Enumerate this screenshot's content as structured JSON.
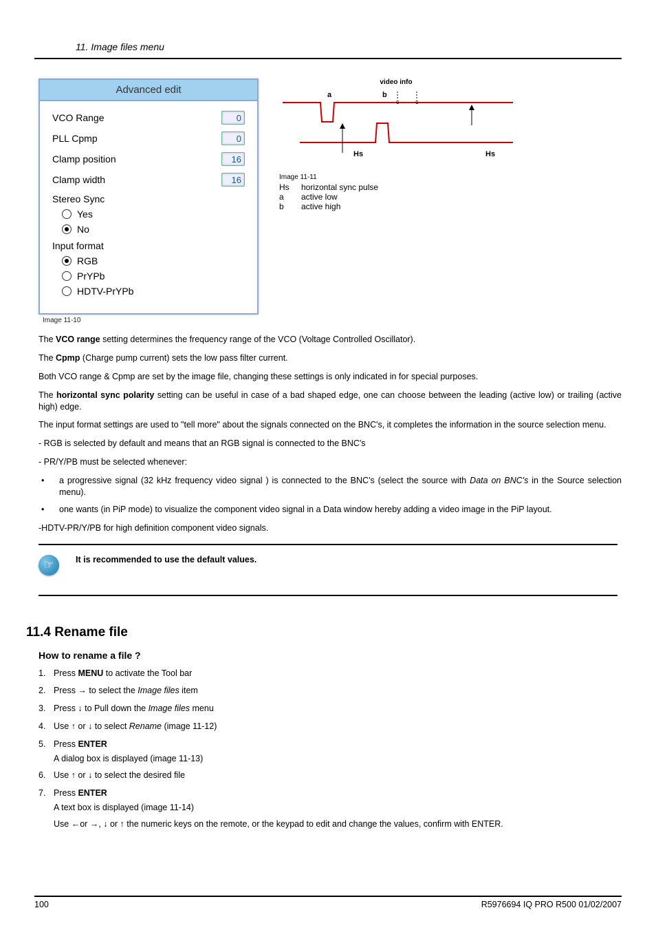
{
  "chapter": "11.  Image files menu",
  "dialog": {
    "title": "Advanced edit",
    "params": [
      {
        "label": "VCO Range",
        "value": "0"
      },
      {
        "label": "PLL Cpmp",
        "value": "0"
      },
      {
        "label": "Clamp position",
        "value": "16"
      },
      {
        "label": "Clamp width",
        "value": "16"
      }
    ],
    "stereo_label": "Stereo Sync",
    "stereo_yes": "Yes",
    "stereo_no": "No",
    "format_label": "Input format",
    "format_rgb": "RGB",
    "format_prypb": "PrYPb",
    "format_hdtv": "HDTV-PrYPb"
  },
  "img_caption_left": "Image 11-10",
  "diagram": {
    "title": "video info",
    "a": "a",
    "b": "b",
    "hs1": "Hs",
    "hs2": "Hs",
    "caption": "Image 11-11",
    "legend": [
      {
        "k": "Hs",
        "v": "horizontal sync pulse"
      },
      {
        "k": "a",
        "v": "active low"
      },
      {
        "k": "b",
        "v": "active high"
      }
    ]
  },
  "para": {
    "p1a": "The ",
    "p1b": "VCO range",
    "p1c": " setting determines the frequency range of the VCO (Voltage Controlled Oscillator).",
    "p2a": "The ",
    "p2b": "Cpmp",
    "p2c": " (Charge pump current) sets the low pass filter current.",
    "p3": "Both VCO range & Cpmp are set by the image file, changing these settings is only indicated in for special purposes.",
    "p4a": "The ",
    "p4b": "horizontal sync polarity",
    "p4c": " setting can be useful in case of a bad shaped edge, one can choose between the leading (active low) or trailing (active high) edge.",
    "p5": "The input format settings are used to \"tell more\" about the signals connected on the BNC's, it completes the information in the source selection menu.",
    "p6": "- RGB is selected by default and means that an RGB signal is connected to the BNC's",
    "p7": "- PR/Y/PB must be selected whenever:",
    "b1a": "a progressive signal (32 kHz frequency video signal ) is connected to the BNC's (select the source with ",
    "b1b": "Data on BNC's",
    "b1c": " in the Source selection menu).",
    "b2": "one wants (in PiP mode) to visualize the component video signal in a Data window hereby adding a video image in the PiP layout.",
    "p8": "-HDTV-PR/Y/PB for high definition component video signals.",
    "note": "It is recommended to use the default values."
  },
  "section": {
    "h2": "11.4  Rename file",
    "h3": "How to rename a file ?",
    "s1a": "Press ",
    "s1b": "MENU",
    "s1c": " to activate the Tool bar",
    "s2a": "Press → to select the ",
    "s2b": "Image files",
    "s2c": " item",
    "s3a": "Press ↓ to Pull down the ",
    "s3b": "Image files",
    "s3c": " menu",
    "s4a": "Use ↑ or ↓ to select ",
    "s4b": "Rename",
    "s4c": " (image 11-12)",
    "s5a": "Press ",
    "s5b": "ENTER",
    "s5sub": "A dialog box is displayed (image 11-13)",
    "s6": "Use ↑ or ↓ to select the desired file",
    "s7a": "Press ",
    "s7b": "ENTER",
    "s7sub1": "A text box is displayed (image 11-14)",
    "s7sub2": "Use ←or →, ↓ or ↑ the numeric keys on the remote, or the keypad to edit and change the values, confirm with ENTER."
  },
  "footer": {
    "page": "100",
    "ref": "R5976694  IQ PRO R500  01/02/2007"
  }
}
